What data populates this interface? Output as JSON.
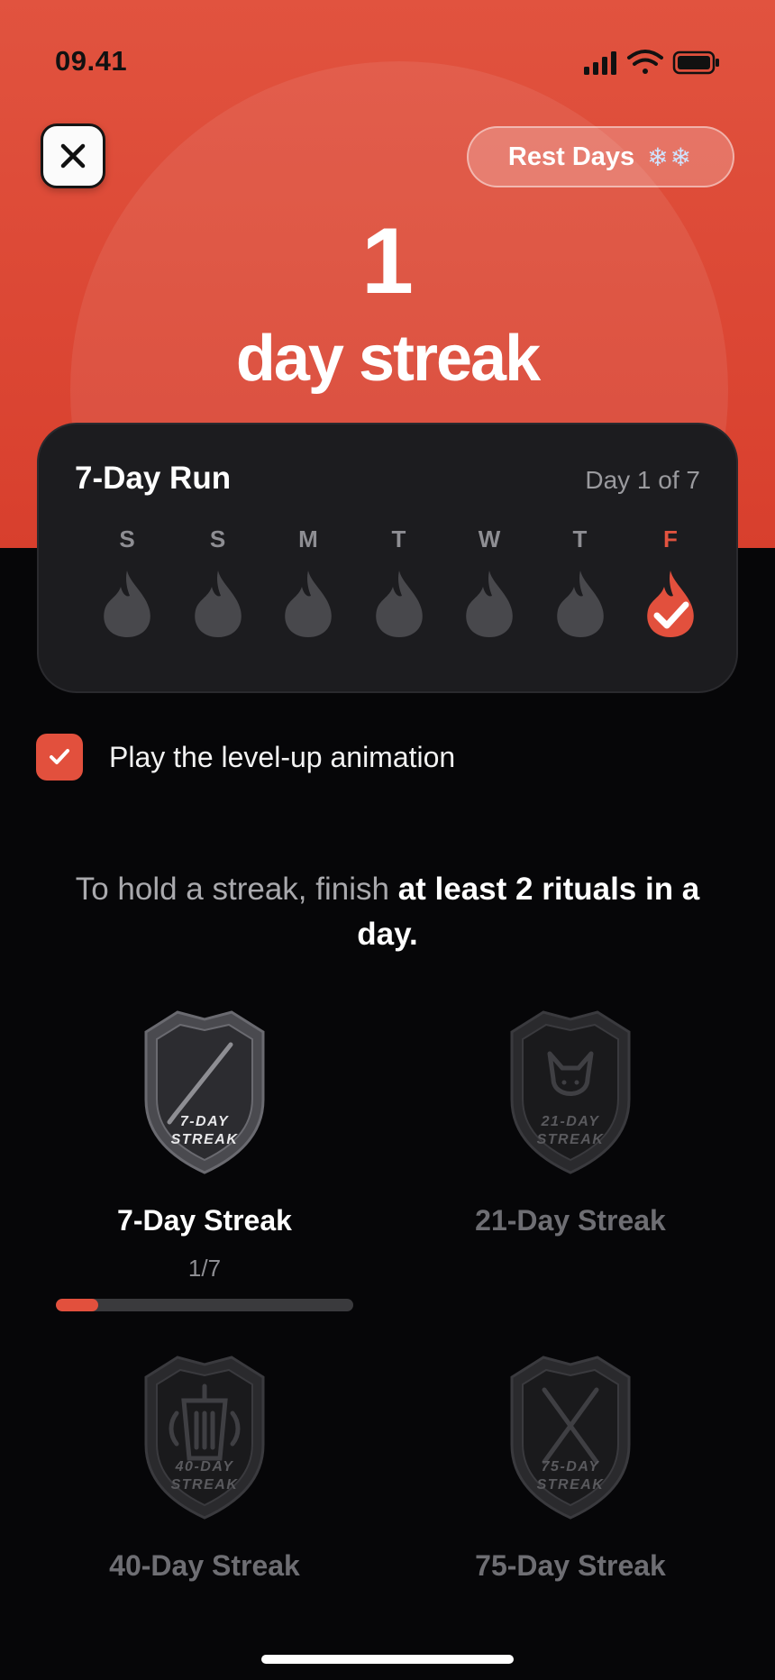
{
  "status_bar": {
    "time": "09.41"
  },
  "header": {
    "close_icon": "close-icon",
    "rest_days_label": "Rest Days",
    "rest_days_icons": "❄❄",
    "streak_count": "1",
    "streak_label": "day streak"
  },
  "run": {
    "title": "7-Day Run",
    "progress_text": "Day 1 of 7",
    "days": [
      {
        "letter": "S",
        "state": "empty"
      },
      {
        "letter": "S",
        "state": "empty"
      },
      {
        "letter": "M",
        "state": "empty"
      },
      {
        "letter": "T",
        "state": "empty"
      },
      {
        "letter": "W",
        "state": "empty"
      },
      {
        "letter": "T",
        "state": "empty"
      },
      {
        "letter": "F",
        "state": "done"
      }
    ]
  },
  "options": {
    "animation_label": "Play the level-up animation",
    "animation_checked": true
  },
  "info": {
    "prefix": "To hold a streak, finish ",
    "emphasis": "at least 2 rituals in a day."
  },
  "badges": [
    {
      "name": "7-Day Streak",
      "badge_line1": "7-DAY",
      "badge_line2": "STREAK",
      "emblem": "pen-icon",
      "count": "1/7",
      "progress": 0.143,
      "active": true
    },
    {
      "name": "21-Day Streak",
      "badge_line1": "21-DAY",
      "badge_line2": "STREAK",
      "emblem": "cat-icon",
      "active": false
    },
    {
      "name": "40-Day Streak",
      "badge_line1": "40-DAY",
      "badge_line2": "STREAK",
      "emblem": "cup-icon",
      "active": false
    },
    {
      "name": "75-Day Streak",
      "badge_line1": "75-DAY",
      "badge_line2": "STREAK",
      "emblem": "crossed-sticks-icon",
      "active": false
    }
  ],
  "colors": {
    "accent": "#e2503d",
    "background": "#060608",
    "card": "#1c1c1f"
  }
}
